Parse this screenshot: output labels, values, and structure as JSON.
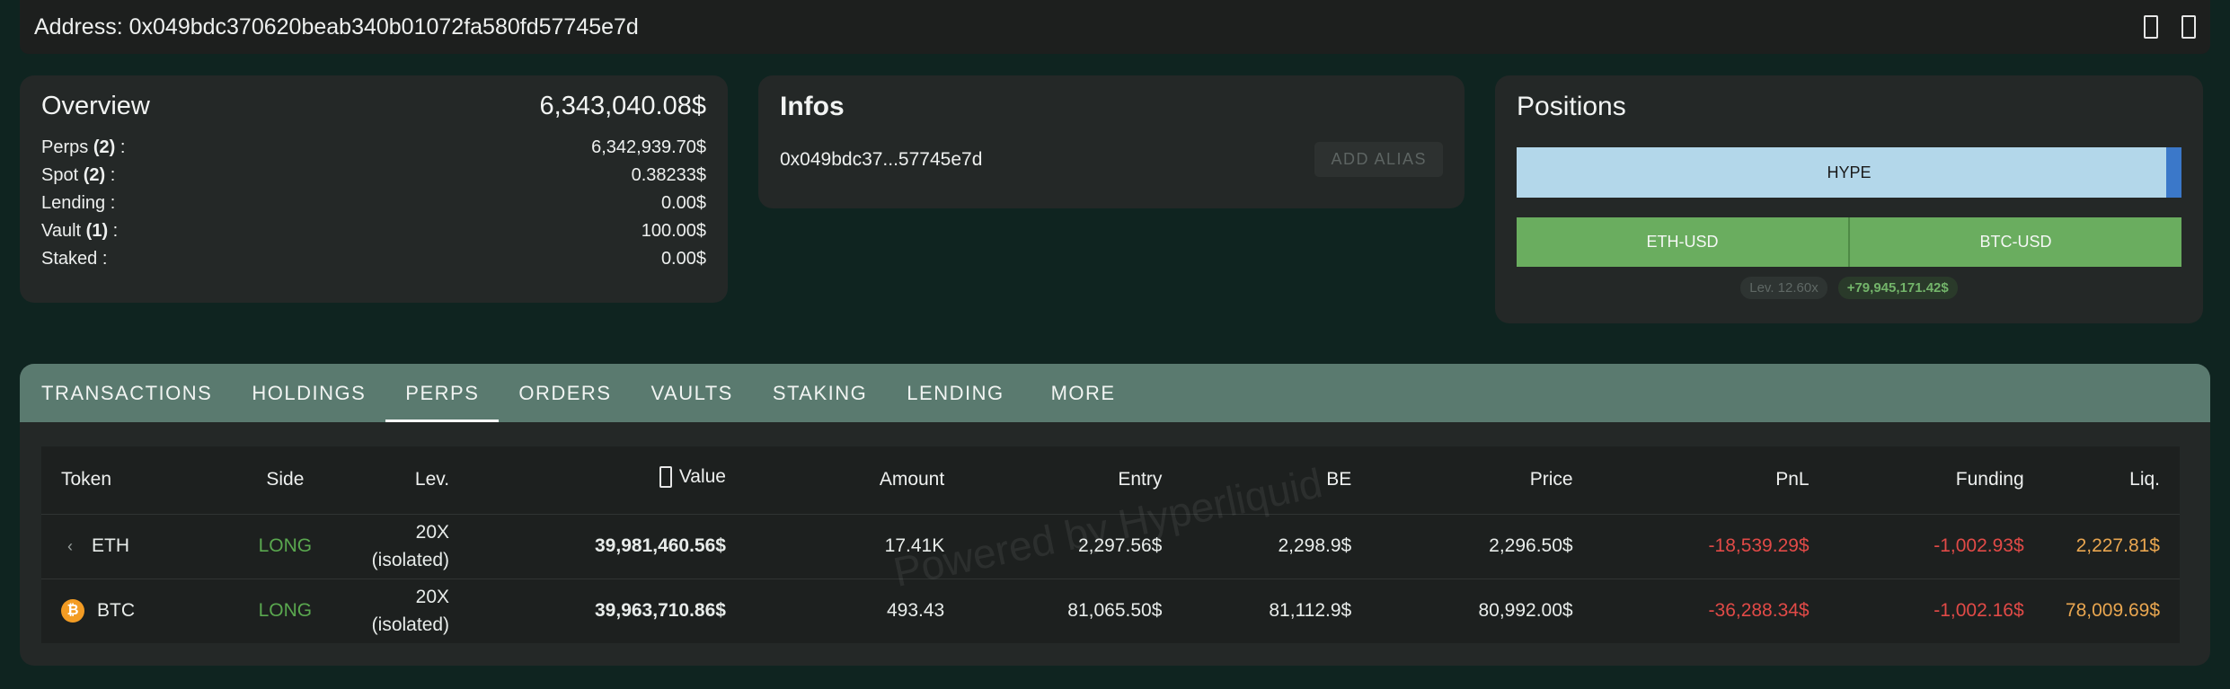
{
  "address_bar": {
    "text": "Address: 0x049bdc370620beab340b01072fa580fd57745e7d",
    "icons": [
      "box-icon",
      "box-icon"
    ]
  },
  "overview": {
    "title": "Overview",
    "total": "6,343,040.08$",
    "rows": [
      {
        "label": "Perps",
        "count": "(2)",
        "suffix": " :",
        "value": "6,342,939.70$"
      },
      {
        "label": "Spot",
        "count": "(2)",
        "suffix": " :",
        "value": "0.38233$"
      },
      {
        "label": "Lending :",
        "count": "",
        "suffix": "",
        "value": "0.00$"
      },
      {
        "label": "Vault",
        "count": "(1)",
        "suffix": " :",
        "value": "100.00$"
      },
      {
        "label": "Staked :",
        "count": "",
        "suffix": "",
        "value": "0.00$"
      }
    ]
  },
  "infos": {
    "title": "Infos",
    "short_address": "0x049bdc37...57745e7d",
    "add_alias_label": "ADD ALIAS"
  },
  "positions": {
    "title": "Positions",
    "hype_label": "HYPE",
    "pairs": [
      "ETH-USD",
      "BTC-USD"
    ],
    "leverage_badge": "Lev. 12.60x",
    "pnl_badge": "+79,945,171.42$"
  },
  "tabs": [
    "TRANSACTIONS",
    "HOLDINGS",
    "PERPS",
    "ORDERS",
    "VAULTS",
    "STAKING",
    "LENDING",
    "MORE"
  ],
  "active_tab": "PERPS",
  "table": {
    "headers": {
      "token": "Token",
      "side": "Side",
      "lev": "Lev.",
      "value": "Value",
      "amount": "Amount",
      "entry": "Entry",
      "be": "BE",
      "price": "Price",
      "pnl": "PnL",
      "funding": "Funding",
      "liq": "Liq."
    },
    "rows": [
      {
        "icon": "eth-icon",
        "token": "ETH",
        "side": "LONG",
        "lev": "20X",
        "lev_mode": "(isolated)",
        "value": "39,981,460.56$",
        "amount": "17.41K",
        "entry": "2,297.56$",
        "be": "2,298.9$",
        "price": "2,296.50$",
        "pnl": "-18,539.29$",
        "funding": "-1,002.93$",
        "liq": "2,227.81$"
      },
      {
        "icon": "btc-icon",
        "token": "BTC",
        "side": "LONG",
        "lev": "20X",
        "lev_mode": "(isolated)",
        "value": "39,963,710.86$",
        "amount": "493.43",
        "entry": "81,065.50$",
        "be": "81,112.9$",
        "price": "80,992.00$",
        "pnl": "-36,288.34$",
        "funding": "-1,002.16$",
        "liq": "78,009.69$"
      }
    ]
  },
  "watermark": "Powered by Hyperliquid",
  "colors": {
    "background": "#0f2420",
    "card": "#242827",
    "tabbar": "#5a7a6f",
    "long_green": "#5aa84f",
    "negative_red": "#e14a47",
    "liq_orange": "#e9a650",
    "hype_blue": "#b3d7ea",
    "pair_green": "#6aad5f"
  }
}
